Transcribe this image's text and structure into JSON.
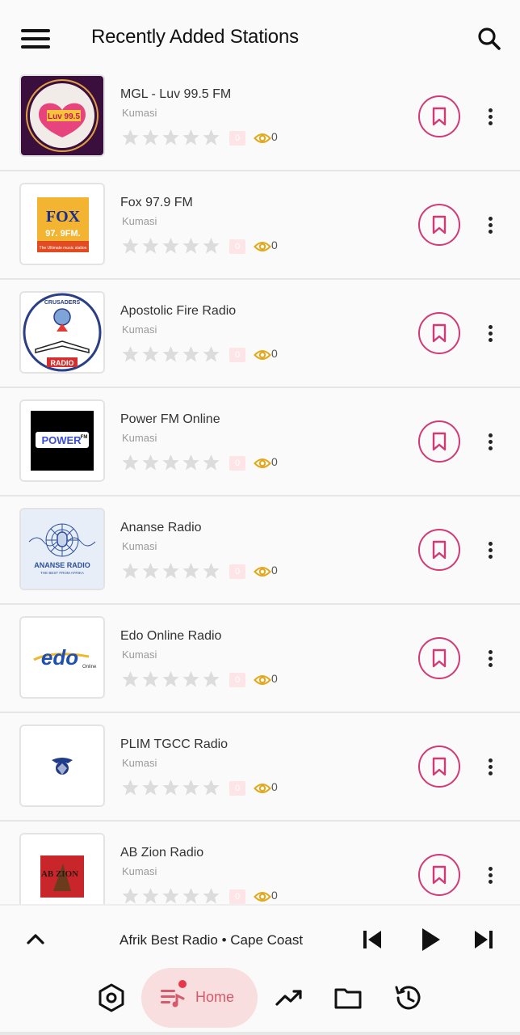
{
  "header": {
    "title": "Recently Added Stations",
    "menu_icon": "hamburger-menu-icon",
    "search_icon": "search-icon"
  },
  "stations": [
    {
      "name": "MGL - Luv 99.5 FM",
      "city": "Kumasi",
      "rating": "0",
      "views": "0",
      "logo_text": "Luv 99.5",
      "logo_bg": "#3a0f3e",
      "logo_accent": "#e5276b"
    },
    {
      "name": "Fox 97.9 FM",
      "city": "Kumasi",
      "rating": "0",
      "views": "0",
      "logo_text": "FOX",
      "logo_sub": "97. 9FM.",
      "logo_tag": "The Ultimate music station",
      "logo_bg": "#f3b432",
      "logo_accent": "#1a2e8f"
    },
    {
      "name": "Apostolic Fire Radio",
      "city": "Kumasi",
      "rating": "0",
      "views": "0",
      "logo_text": "CRUSADERS",
      "logo_sub": "RADIO",
      "logo_accent": "#2b3f87"
    },
    {
      "name": "Power FM Online",
      "city": "Kumasi",
      "rating": "0",
      "views": "0",
      "logo_text": "POWER",
      "logo_sub": "FM",
      "logo_bg": "#000000",
      "logo_accent": "#3a4bd8"
    },
    {
      "name": "Ananse Radio",
      "city": "Kumasi",
      "rating": "0",
      "views": "0",
      "logo_text": "ANANSE RADIO",
      "logo_sub": "THE BEST FROM AFRIKA",
      "logo_bg": "#e8eef7",
      "logo_accent": "#2d4f9e"
    },
    {
      "name": "Edo Online Radio",
      "city": "Kumasi",
      "rating": "0",
      "views": "0",
      "logo_text": "edo",
      "logo_sub": "Online",
      "logo_accent": "#1f4fb0"
    },
    {
      "name": "PLIM TGCC Radio",
      "city": "Kumasi",
      "rating": "0",
      "views": "0",
      "logo_accent": "#1f3b8a"
    },
    {
      "name": "AB Zion Radio",
      "city": "Kumasi",
      "rating": "0",
      "views": "0",
      "logo_text": "AB ZION",
      "logo_accent": "#c9262c"
    }
  ],
  "player": {
    "now_playing": "Afrik Best Radio • Cape Coast"
  },
  "nav": {
    "home_label": "Home",
    "items": [
      "radio-icon",
      "home-queue-icon",
      "trending-icon",
      "folder-icon",
      "history-icon"
    ]
  },
  "colors": {
    "accent": "#d23a75",
    "badge_bg": "#fde4e6",
    "eye": "#e3a81a",
    "star": "#dcdcdc",
    "home_pill": "#f8dede"
  }
}
